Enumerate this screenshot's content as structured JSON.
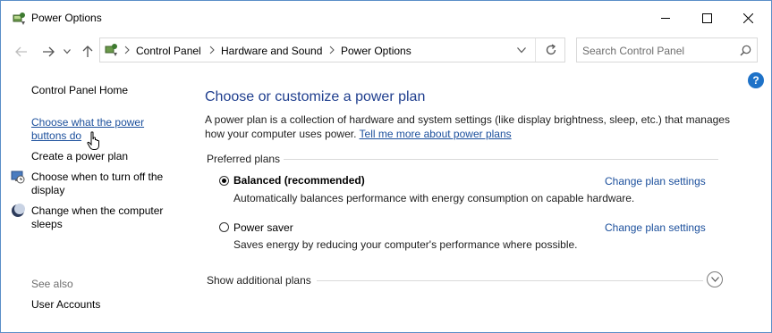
{
  "window": {
    "title": "Power Options",
    "controls": [
      "minimize",
      "maximize",
      "close"
    ]
  },
  "nav": {
    "breadcrumbs": [
      "Control Panel",
      "Hardware and Sound",
      "Power Options"
    ],
    "search_placeholder": "Search Control Panel"
  },
  "sidebar": {
    "home": "Control Panel Home",
    "links": [
      {
        "label_line1": "Choose what the power",
        "label_line2": "buttons do",
        "icon": "none"
      },
      {
        "label_line1": "Create a power plan",
        "icon": "none"
      },
      {
        "label_line1": "Choose when to turn off the",
        "label_line2": "display",
        "icon": "monitor-clock-icon"
      },
      {
        "label_line1": "Change when the computer",
        "label_line2": "sleeps",
        "icon": "moon-icon"
      }
    ],
    "see_also": "See also",
    "user_accounts": "User Accounts"
  },
  "main": {
    "heading": "Choose or customize a power plan",
    "desc_line1": "A power plan is a collection of hardware and system settings (like display brightness, sleep, etc.) that manages",
    "desc_line2": "how your computer uses power.",
    "desc_link": "Tell me more about power plans",
    "group_title": "Preferred plans",
    "plans": [
      {
        "name": "Balanced (recommended)",
        "selected": true,
        "description": "Automatically balances performance with energy consumption on capable hardware.",
        "link": "Change plan settings"
      },
      {
        "name": "Power saver",
        "selected": false,
        "description": "Saves energy by reducing your computer's performance where possible.",
        "link": "Change plan settings"
      }
    ],
    "show_additional": "Show additional plans"
  },
  "colors": {
    "heading": "#1f3e8e",
    "link": "#1b4f9c",
    "help": "#1e72c8"
  }
}
